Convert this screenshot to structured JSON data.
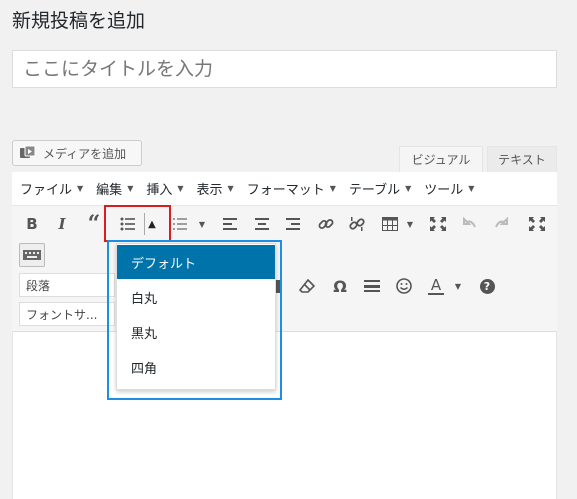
{
  "page": {
    "title": "新規投稿を追加"
  },
  "post": {
    "title_placeholder": "ここにタイトルを入力"
  },
  "media": {
    "add_media_label": "メディアを追加"
  },
  "editor_tabs": {
    "visual": "ビジュアル",
    "text": "テキスト"
  },
  "menubar": {
    "items": [
      {
        "label": "ファイル"
      },
      {
        "label": "編集"
      },
      {
        "label": "挿入"
      },
      {
        "label": "表示"
      },
      {
        "label": "フォーマット"
      },
      {
        "label": "テーブル"
      },
      {
        "label": "ツール"
      }
    ]
  },
  "toolbar": {
    "bold": "B",
    "italic": "I",
    "blockquote": "“",
    "omega": "Ω",
    "text_color": "A",
    "help": "?",
    "format_select": "段落",
    "font_select": "フォントサ..."
  },
  "bullet_style_menu": {
    "items": [
      {
        "label": "デフォルト",
        "active": true
      },
      {
        "label": "白丸",
        "active": false
      },
      {
        "label": "黒丸",
        "active": false
      },
      {
        "label": "四角",
        "active": false
      }
    ]
  },
  "colors": {
    "accent": "#0073aa",
    "highlight_red": "#d81e1e",
    "highlight_blue": "#1a8fe3"
  }
}
